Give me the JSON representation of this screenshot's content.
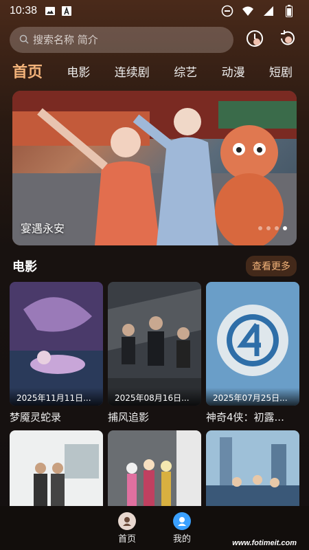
{
  "status_bar": {
    "time": "10:38",
    "icons": [
      "image-icon",
      "a-icon",
      "dnd-icon",
      "wifi-icon",
      "signal-icon",
      "battery-icon"
    ]
  },
  "search": {
    "placeholder": "搜索名称 简介"
  },
  "header_buttons": [
    "history-icon",
    "refresh-icon"
  ],
  "tabs": [
    {
      "label": "首页",
      "active": true
    },
    {
      "label": "电影",
      "active": false
    },
    {
      "label": "连续剧",
      "active": false
    },
    {
      "label": "综艺",
      "active": false
    },
    {
      "label": "动漫",
      "active": false
    },
    {
      "label": "短剧",
      "active": false
    }
  ],
  "banner": {
    "title": "宴遇永安",
    "dots_total": 4,
    "dot_active": 4
  },
  "section": {
    "title": "电影",
    "more": "查看更多"
  },
  "movies": [
    {
      "title": "梦魇灵蛇录",
      "date": "2025年11月11日..."
    },
    {
      "title": "捕风追影",
      "date": "2025年08月16日..."
    },
    {
      "title": "神奇4侠：初露...",
      "date": "2025年07月25日..."
    }
  ],
  "bottom_nav": [
    {
      "label": "首页",
      "icon": "home-icon"
    },
    {
      "label": "我的",
      "icon": "profile-icon"
    }
  ],
  "watermark": {
    "url": "www.fotimeit.com"
  },
  "colors": {
    "accent": "#f3b37a",
    "background": "#181210"
  }
}
